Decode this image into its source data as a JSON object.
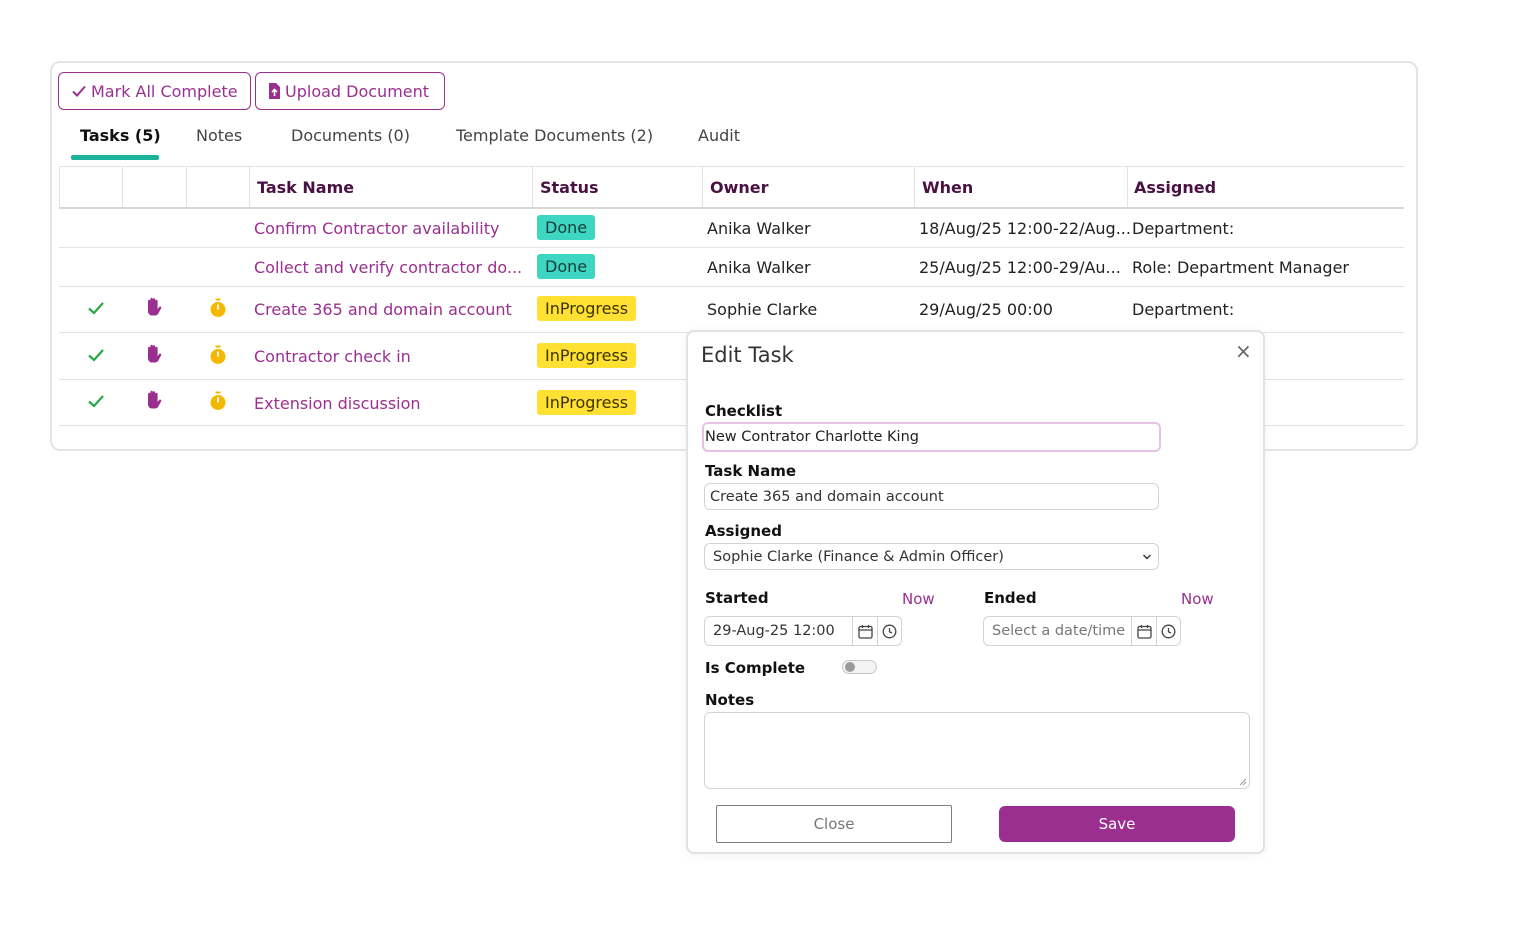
{
  "toolbar": {
    "mark_all_label": "Mark All Complete",
    "upload_label": "Upload Document"
  },
  "tabs": [
    {
      "label": "Tasks (5)",
      "active": true
    },
    {
      "label": "Notes",
      "active": false
    },
    {
      "label": "Documents (0)",
      "active": false
    },
    {
      "label": "Template Documents (2)",
      "active": false
    },
    {
      "label": "Audit",
      "active": false
    }
  ],
  "table": {
    "headers": [
      "Task Name",
      "Status",
      "Owner",
      "When",
      "Assigned"
    ],
    "rows": [
      {
        "task": "Confirm Contractor availability",
        "status": "Done",
        "owner": "Anika Walker",
        "when": "18/Aug/25 12:00-22/Aug...",
        "assigned": "Department:",
        "actions": false
      },
      {
        "task": "Collect and verify contractor do...",
        "status": "Done",
        "owner": "Anika Walker",
        "when": "25/Aug/25 12:00-29/Au...",
        "assigned": "Role: Department Manager",
        "actions": false
      },
      {
        "task": "Create 365 and domain account",
        "status": "InProgress",
        "owner": "Sophie Clarke",
        "when": "29/Aug/25 00:00",
        "assigned": "Department:",
        "actions": true
      },
      {
        "task": "Contractor check in",
        "status": "InProgress",
        "owner": "",
        "when": "",
        "assigned": "",
        "actions": true
      },
      {
        "task": "Extension discussion",
        "status": "InProgress",
        "owner": "",
        "when": "",
        "assigned": "",
        "actions": true
      }
    ],
    "row_icons": [
      "check-icon",
      "hand-icon",
      "stopwatch-icon"
    ]
  },
  "modal": {
    "title": "Edit Task",
    "close_symbol": "×",
    "checklist_label": "Checklist",
    "checklist_value": "New Contrator Charlotte King",
    "task_name_label": "Task Name",
    "task_name_value": "Create 365 and domain account",
    "assigned_label": "Assigned",
    "assigned_value": "Sophie Clarke (Finance & Admin Officer)",
    "started_label": "Started",
    "started_now": "Now",
    "started_value": "29-Aug-25 12:00",
    "ended_label": "Ended",
    "ended_now": "Now",
    "ended_placeholder": "Select a date/time",
    "is_complete_label": "Is Complete",
    "is_complete": false,
    "notes_label": "Notes",
    "notes_value": "",
    "close_button": "Close",
    "save_button": "Save"
  },
  "colors": {
    "brand": "#9b2f8f",
    "tab_underline": "#1bb39b",
    "done_badge": "#3dd6c2",
    "inprogress_badge": "#ffe033",
    "check_green": "#27a844",
    "stopwatch_amber": "#f5b800"
  }
}
